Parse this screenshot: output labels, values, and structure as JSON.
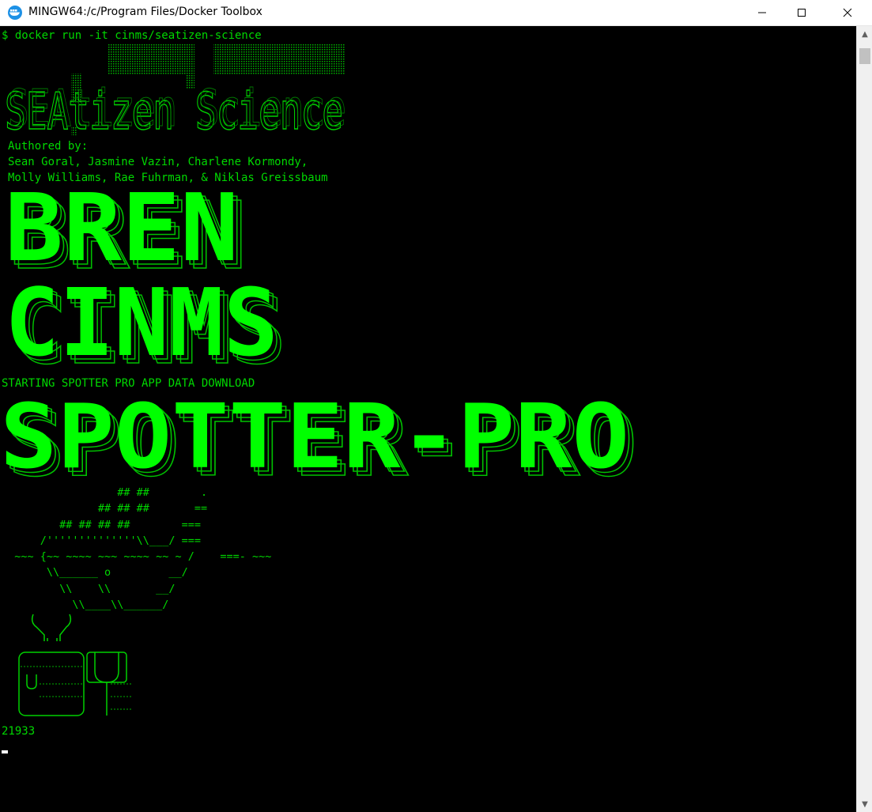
{
  "window": {
    "title": "MINGW64:/c/Program Files/Docker Toolbox",
    "app_icon": "docker-toolbox-icon",
    "controls": {
      "minimize_icon": "minimize-icon",
      "maximize_icon": "maximize-icon",
      "close_icon": "close-icon"
    }
  },
  "terminal": {
    "command_line": "$ docker run -it cinms/seatizen-science",
    "banner_seatizen": "SEAtizen Science",
    "authors": "Authored by:\nSean Goral, Jasmine Vazin, Charlene Kormondy,\nMolly Williams, Rae Fuhrman, & Niklas Greissbaum",
    "banner_bren": "BREN",
    "banner_cinms": "CINMS",
    "starting_line": "STARTING SPOTTER PRO APP DATA DOWNLOAD",
    "banner_spotter": "SPOTTER-PRO",
    "docker_whale": "                  ## ##        .\n               ## ## ##       ==\n         ## ## ## ##        ===\n      /''''''''''''''\\\\___/ ===\n  ~~~ {~~ ~~~~ ~~~ ~~~~ ~~ ~ /    ===- ~~~\n       \\\\______ o         __/\n         \\\\    \\\\       __/\n           \\\\____\\\\______/",
    "logo_label": "UCSB Bren School logo",
    "count_line": "21933",
    "colors": {
      "background": "#000000",
      "text": "#00d800",
      "banner": "#00ff00"
    }
  },
  "scrollbar": {
    "up_icon": "scroll-up-arrow-icon",
    "down_icon": "scroll-down-arrow-icon"
  }
}
